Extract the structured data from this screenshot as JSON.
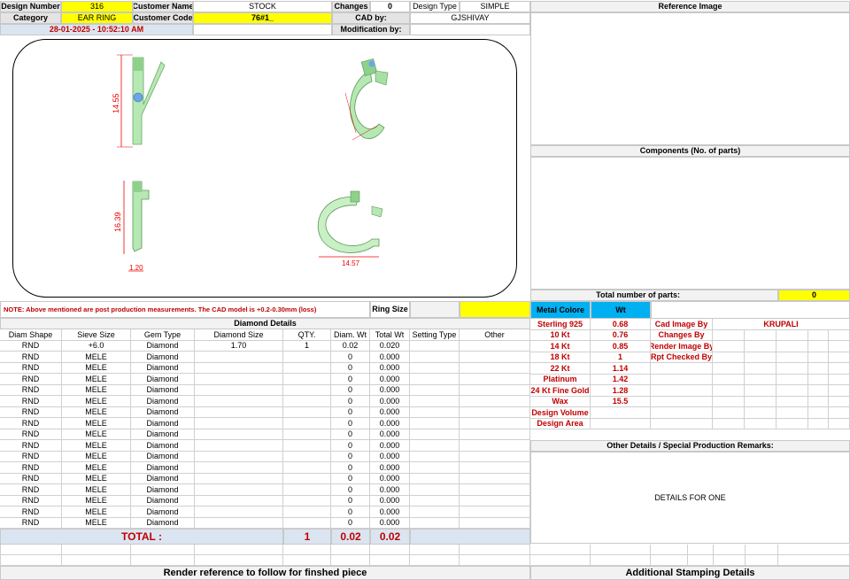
{
  "header": {
    "design_number_label": "Design Number",
    "design_number": "316",
    "customer_name_label": "Customer Name",
    "customer_name": "STOCK",
    "changes_label": "Changes",
    "changes": "0",
    "design_type_label": "Design Type",
    "design_type": "SIMPLE",
    "category_label": "Category",
    "category": "EAR RING",
    "customer_code_label": "Customer Code",
    "customer_code": "76#1_",
    "cad_by_label": "CAD by:",
    "cad_by": "GJSHIVAY",
    "timestamp": "28-01-2025 - 10:52:10 AM",
    "modification_label": "Modification by:"
  },
  "drawing": {
    "dim_height_front": "14.55",
    "dim_height_side": "16.39",
    "dim_width_side": "1.20",
    "dim_width_top": "14.57"
  },
  "right_panel": {
    "reference_image": "Reference Image",
    "components": "Components (No. of parts)",
    "total_parts_label": "Total number of parts:",
    "total_parts": "0"
  },
  "note": "NOTE: Above mentioned are post production measurements. The CAD model is +0.2-0.30mm (loss)",
  "ring_size_label": "Ring Size",
  "diamond": {
    "title": "Diamond Details",
    "columns": [
      "Diam Shape",
      "Sieve Size",
      "Gem Type",
      "Diamond Size",
      "QTY.",
      "Diam. Wt",
      "Total Wt",
      "Setting Type",
      "Other"
    ],
    "rows": [
      [
        "RND",
        "+6.0",
        "Diamond",
        "1.70",
        "1",
        "0.02",
        "0.020",
        "",
        ""
      ],
      [
        "RND",
        "MELE",
        "Diamond",
        "",
        "",
        "0",
        "0.000",
        "",
        ""
      ],
      [
        "RND",
        "MELE",
        "Diamond",
        "",
        "",
        "0",
        "0.000",
        "",
        ""
      ],
      [
        "RND",
        "MELE",
        "Diamond",
        "",
        "",
        "0",
        "0.000",
        "",
        ""
      ],
      [
        "RND",
        "MELE",
        "Diamond",
        "",
        "",
        "0",
        "0.000",
        "",
        ""
      ],
      [
        "RND",
        "MELE",
        "Diamond",
        "",
        "",
        "0",
        "0.000",
        "",
        ""
      ],
      [
        "RND",
        "MELE",
        "Diamond",
        "",
        "",
        "0",
        "0.000",
        "",
        ""
      ],
      [
        "RND",
        "MELE",
        "Diamond",
        "",
        "",
        "0",
        "0.000",
        "",
        ""
      ],
      [
        "RND",
        "MELE",
        "Diamond",
        "",
        "",
        "0",
        "0.000",
        "",
        ""
      ],
      [
        "RND",
        "MELE",
        "Diamond",
        "",
        "",
        "0",
        "0.000",
        "",
        ""
      ],
      [
        "RND",
        "MELE",
        "Diamond",
        "",
        "",
        "0",
        "0.000",
        "",
        ""
      ],
      [
        "RND",
        "MELE",
        "Diamond",
        "",
        "",
        "0",
        "0.000",
        "",
        ""
      ],
      [
        "RND",
        "MELE",
        "Diamond",
        "",
        "",
        "0",
        "0.000",
        "",
        ""
      ],
      [
        "RND",
        "MELE",
        "Diamond",
        "",
        "",
        "0",
        "0.000",
        "",
        ""
      ],
      [
        "RND",
        "MELE",
        "Diamond",
        "",
        "",
        "0",
        "0.000",
        "",
        ""
      ],
      [
        "RND",
        "MELE",
        "Diamond",
        "",
        "",
        "0",
        "0.000",
        "",
        ""
      ],
      [
        "RND",
        "MELE",
        "Diamond",
        "",
        "",
        "0",
        "0.000",
        "",
        ""
      ]
    ],
    "total_label": "TOTAL :",
    "total_qty": "1",
    "total_diam_wt": "0.02",
    "total_wt": "0.02"
  },
  "metal": {
    "header_color": "Metal Colore",
    "header_wt": "Wt",
    "rows": [
      {
        "name": "Sterling 925",
        "wt": "0.68",
        "label": "Cad Image By",
        "value": "KRUPALI"
      },
      {
        "name": "10 Kt",
        "wt": "0.76",
        "label": "Changes By",
        "value": ""
      },
      {
        "name": "14 Kt",
        "wt": "0.85",
        "label": "Render Image By",
        "value": ""
      },
      {
        "name": "18 Kt",
        "wt": "1",
        "label": "Rpt Checked By",
        "value": ""
      },
      {
        "name": "22 Kt",
        "wt": "1.14",
        "label": "",
        "value": ""
      },
      {
        "name": "Platinum",
        "wt": "1.42",
        "label": "",
        "value": ""
      },
      {
        "name": "24 Kt Fine Gold",
        "wt": "1.28",
        "label": "",
        "value": ""
      },
      {
        "name": "Wax",
        "wt": "15.5",
        "label": "",
        "value": ""
      },
      {
        "name": "Design Volume",
        "wt": "",
        "label": "",
        "value": ""
      },
      {
        "name": "Design Area",
        "wt": "",
        "label": "",
        "value": ""
      }
    ]
  },
  "other_details": {
    "title": "Other Details / Special Production Remarks:",
    "text": "DETAILS FOR ONE"
  },
  "footer": {
    "render_ref": "Render reference to follow for finshed piece",
    "stamping": "Additional Stamping Details"
  }
}
